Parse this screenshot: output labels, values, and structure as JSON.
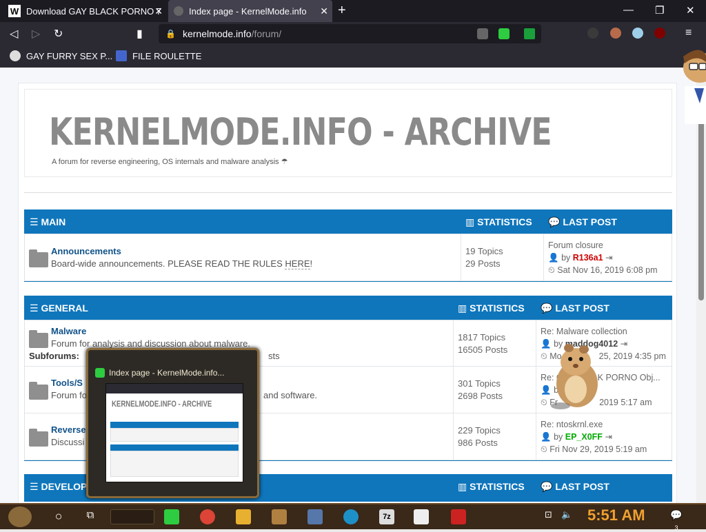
{
  "browser": {
    "tabs": [
      {
        "title": "Download GAY BLACK PORNO 7",
        "favicon_letter": "W"
      },
      {
        "title": "Index page - KernelMode.info"
      }
    ],
    "url_domain": "kernelmode.info",
    "url_path": "/forum/",
    "bookmarks": [
      {
        "label": "GAY FURRY SEX P..."
      },
      {
        "label": "FILE ROULETTE"
      }
    ]
  },
  "site": {
    "title": "KERNELMODE.INFO - ARCHIVE",
    "description": "A forum for reverse engineering, OS internals and malware analysis"
  },
  "categories": [
    {
      "name": "MAIN",
      "stats_label": "STATISTICS",
      "last_label": "LAST POST",
      "forums": [
        {
          "title": "Announcements",
          "desc": "Board-wide announcements. PLEASE READ THE RULES",
          "desc_link": "HERE",
          "desc_end": "!",
          "topics": "19 Topics",
          "posts": "29 Posts",
          "last_title": "Forum closure",
          "last_by": "by",
          "last_author": "R136a1",
          "last_date": "Sat Nov 16, 2019 6:08 pm"
        }
      ]
    },
    {
      "name": "GENERAL",
      "stats_label": "STATISTICS",
      "last_label": "LAST POST",
      "forums": [
        {
          "title": "Malware",
          "desc": "Forum for analysis and discussion about malware.",
          "sub_label": "Subforums:",
          "sub_tail": "sts",
          "topics": "1817 Topics",
          "posts": "16505 Posts",
          "last_title": "Re: Malware collection",
          "last_by": "by",
          "last_author": "maddog4012",
          "last_date_a": "Mo",
          "last_date_b": "25, 2019 4:35 pm"
        },
        {
          "title": "Tools/S",
          "desc": "Forum fo",
          "desc_tail": "and software.",
          "topics": "301 Topics",
          "posts": "2698 Posts",
          "last_title": "Re: G",
          "last_title_tail": "K PORNO Obj...",
          "last_by": "by",
          "last_date_a": "Fr",
          "last_date_b": "2019 5:17 am"
        },
        {
          "title": "Reverse",
          "desc": "Discussi",
          "topics": "229 Topics",
          "posts": "986 Posts",
          "last_title": "Re: ntoskrnl.exe",
          "last_by": "by",
          "last_author": "EP_X0FF",
          "last_date": "Fri Nov 29, 2019 5:19 am"
        }
      ]
    },
    {
      "name": "DEVELOP",
      "stats_label": "STATISTICS",
      "last_label": "LAST POST"
    }
  ],
  "thumbnail": {
    "title": "Index page - KernelMode.info...",
    "mini_title": "KERNELMODE.INFO - ARCHIVE"
  },
  "taskbar": {
    "time": "5:51 AM",
    "notif_count": "3"
  },
  "colors": {
    "category_header": "#0f76bc",
    "forum_link": "#105289",
    "author_red": "#cc0000",
    "author_green": "#00aa00",
    "clock": "#f0a030"
  }
}
